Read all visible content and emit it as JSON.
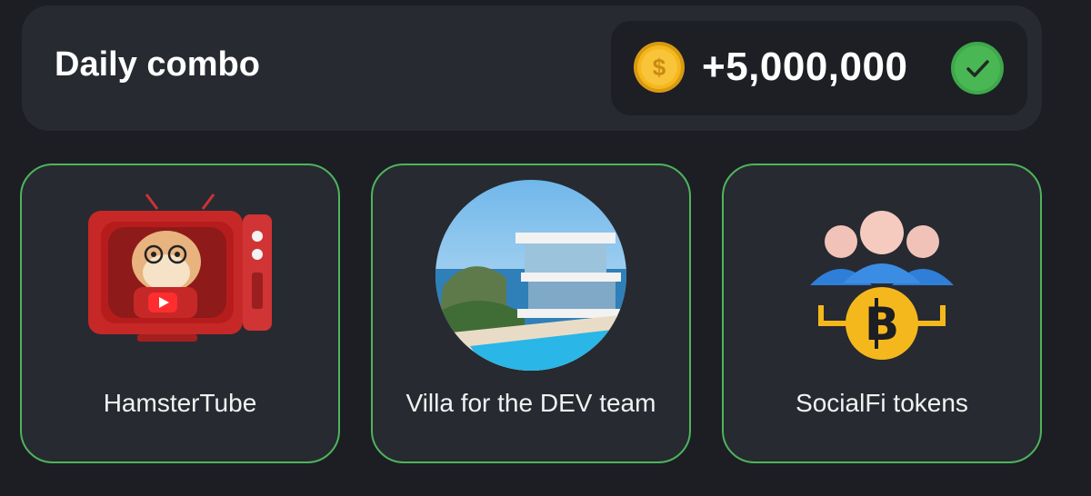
{
  "header": {
    "title": "Daily combo",
    "reward_amount": "+5,000,000",
    "coin_icon": "gold-dollar-coin-icon",
    "status_icon": "green-checkmark-icon"
  },
  "cards": [
    {
      "label": "HamsterTube",
      "image": "hamster-tv-youtube-image"
    },
    {
      "label": "Villa for the DEV team",
      "image": "seaside-villa-image"
    },
    {
      "label": "SocialFi tokens",
      "image": "people-bitcoin-icon"
    }
  ],
  "colors": {
    "background": "#1c1e24",
    "panel": "#272a31",
    "card_border": "#4fb45b",
    "coin": "#f5b81c",
    "check": "#3fa84a"
  }
}
